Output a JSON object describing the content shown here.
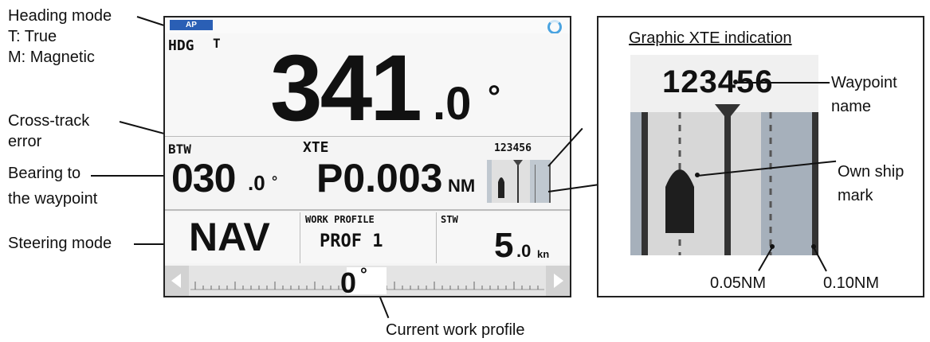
{
  "callouts": {
    "heading_mode": "Heading mode",
    "heading_true": "T: True",
    "heading_magnetic": "M: Magnetic",
    "cross_track_1": "Cross-track",
    "cross_track_2": "error",
    "bearing_1": "Bearing to",
    "bearing_2": "the waypoint",
    "steering_mode": "Steering mode",
    "current_work_profile": "Current work profile",
    "graphic_xte_title": "Graphic XTE indication",
    "waypoint_1": "Waypoint",
    "waypoint_2": "name",
    "own_ship_1": "Own ship",
    "own_ship_2": "mark",
    "scale_005": "0.05NM",
    "scale_010": "0.10NM"
  },
  "display": {
    "ap_badge": "AP",
    "hdg_label": "HDG",
    "hdg_mode": "T",
    "heading_int": "341",
    "heading_dec": ".0",
    "heading_unit": "°",
    "btw_label": "BTW",
    "btw_int": "030",
    "btw_dec": ".0",
    "btw_unit": "°",
    "xte_label": "XTE",
    "xte_value": "P0.003",
    "xte_unit": "NM",
    "waypoint_name": "123456",
    "steering_mode": "NAV",
    "work_profile_label": "WORK PROFILE",
    "work_profile_value": "PROF 1",
    "stw_label": "STW",
    "stw_int": "5",
    "stw_dec": ".0",
    "stw_unit": "kn",
    "rudder_value": "0",
    "rudder_unit": "°"
  },
  "zoom": {
    "waypoint_name": "123456"
  }
}
